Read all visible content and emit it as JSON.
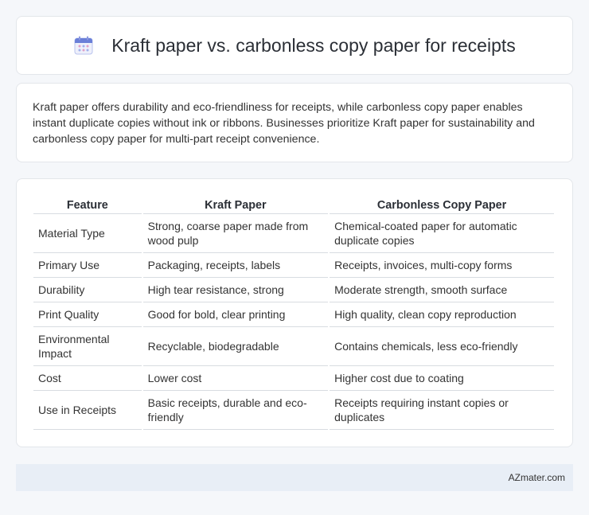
{
  "header": {
    "title": "Kraft paper vs. carbonless copy paper for receipts",
    "icon": "calendar-icon",
    "icon_color": "#6a7fd8"
  },
  "summary": {
    "text": "Kraft paper offers durability and eco-friendliness for receipts, while carbonless copy paper enables instant duplicate copies without ink or ribbons. Businesses prioritize Kraft paper for sustainability and carbonless copy paper for multi-part receipt convenience."
  },
  "table": {
    "headers": [
      "Feature",
      "Kraft Paper",
      "Carbonless Copy Paper"
    ],
    "rows": [
      [
        "Material Type",
        "Strong, coarse paper made from wood pulp",
        "Chemical-coated paper for automatic duplicate copies"
      ],
      [
        "Primary Use",
        "Packaging, receipts, labels",
        "Receipts, invoices, multi-copy forms"
      ],
      [
        "Durability",
        "High tear resistance, strong",
        "Moderate strength, smooth surface"
      ],
      [
        "Print Quality",
        "Good for bold, clear printing",
        "High quality, clean copy reproduction"
      ],
      [
        "Environmental Impact",
        "Recyclable, biodegradable",
        "Contains chemicals, less eco-friendly"
      ],
      [
        "Cost",
        "Lower cost",
        "Higher cost due to coating"
      ],
      [
        "Use in Receipts",
        "Basic receipts, durable and eco-friendly",
        "Receipts requiring instant copies or duplicates"
      ]
    ]
  },
  "footer": {
    "text": "AZmater.com",
    "background": "#e8eef6"
  }
}
